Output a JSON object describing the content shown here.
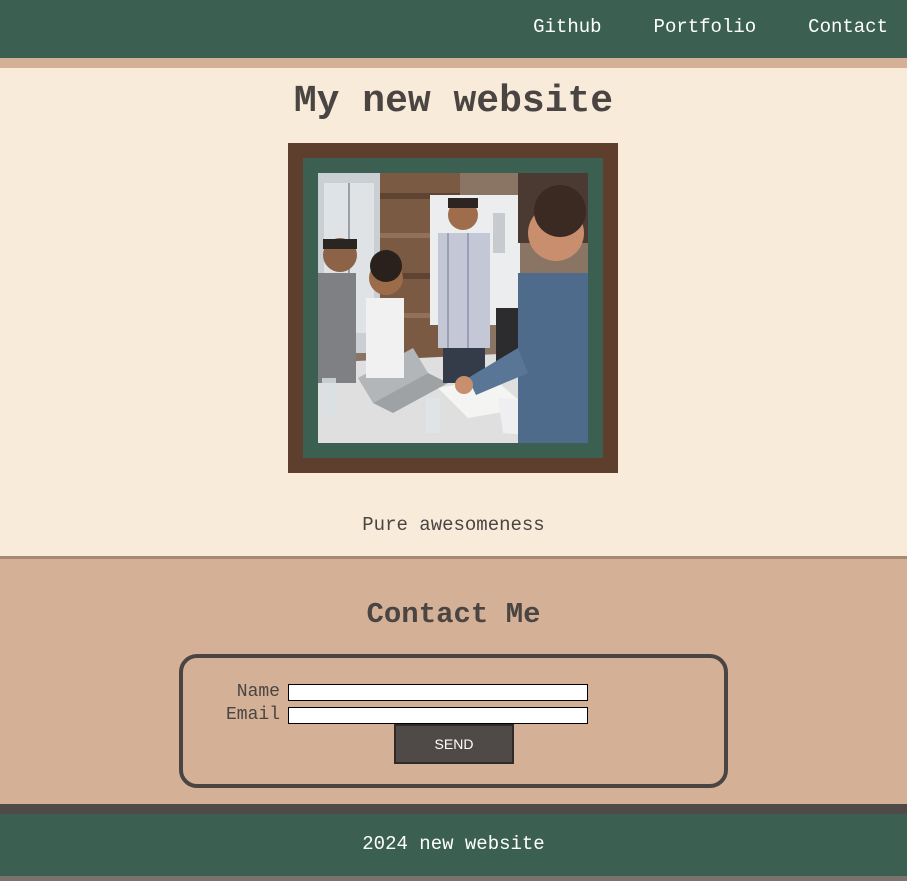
{
  "nav": {
    "items": [
      {
        "label": "Github"
      },
      {
        "label": "Portfolio"
      },
      {
        "label": "Contact"
      }
    ]
  },
  "hero": {
    "title": "My new website",
    "image_icon": "team-meeting-photo",
    "tagline": "Pure awesomeness"
  },
  "contact": {
    "title": "Contact Me",
    "name_label": "Name",
    "name_value": "",
    "email_label": "Email",
    "email_value": "",
    "send_label": "SEND"
  },
  "footer": {
    "text": "2024 new website"
  },
  "colors": {
    "header_green": "#3b5f50",
    "frame_brown": "#5e3f2e",
    "cream": "#f8ebd9",
    "tan": "#d4b196",
    "text_dark": "#4a4543",
    "button_dark": "#4f4947"
  }
}
